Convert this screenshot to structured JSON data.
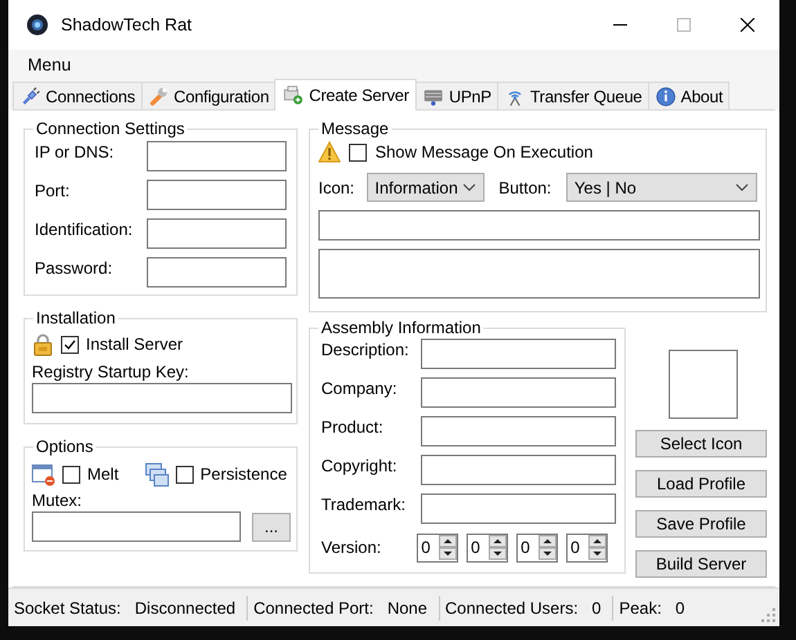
{
  "window": {
    "title": "ShadowTech Rat"
  },
  "menu": [
    "Menu"
  ],
  "tabs": [
    {
      "label": "Connections",
      "selected": false
    },
    {
      "label": "Configuration",
      "selected": false
    },
    {
      "label": "Create Server",
      "selected": true
    },
    {
      "label": "UPnP",
      "selected": false
    },
    {
      "label": "Transfer Queue",
      "selected": false
    },
    {
      "label": "About",
      "selected": false
    }
  ],
  "connection_settings": {
    "title": "Connection Settings",
    "fields": [
      "IP or DNS:",
      "Port:",
      "Identification:",
      "Password:"
    ]
  },
  "installation": {
    "title": "Installation",
    "install_server": {
      "label": "Install Server",
      "checked": true
    },
    "registry_label": "Registry Startup Key:"
  },
  "options": {
    "title": "Options",
    "melt": {
      "label": "Melt",
      "checked": false
    },
    "persistence": {
      "label": "Persistence",
      "checked": false
    },
    "mutex_label": "Mutex:",
    "browse_button": "..."
  },
  "message": {
    "title": "Message",
    "show_message": {
      "label": "Show Message On Execution",
      "checked": false
    },
    "icon_label": "Icon:",
    "icon_value": "Information",
    "button_label": "Button:",
    "button_value": "Yes | No"
  },
  "assembly": {
    "title": "Assembly Information",
    "fields": [
      "Description:",
      "Company:",
      "Product:",
      "Copyright:",
      "Trademark:"
    ],
    "version_label": "Version:",
    "version": [
      "0",
      "0",
      "0",
      "0"
    ]
  },
  "actions": [
    "Select Icon",
    "Load Profile",
    "Save Profile",
    "Build Server"
  ],
  "status_bar": [
    {
      "label": "Socket Status:",
      "value": "Disconnected"
    },
    {
      "label": "Connected Port:",
      "value": "None"
    },
    {
      "label": "Connected Users:",
      "value": "0"
    },
    {
      "label": "Peak:",
      "value": "0"
    }
  ]
}
